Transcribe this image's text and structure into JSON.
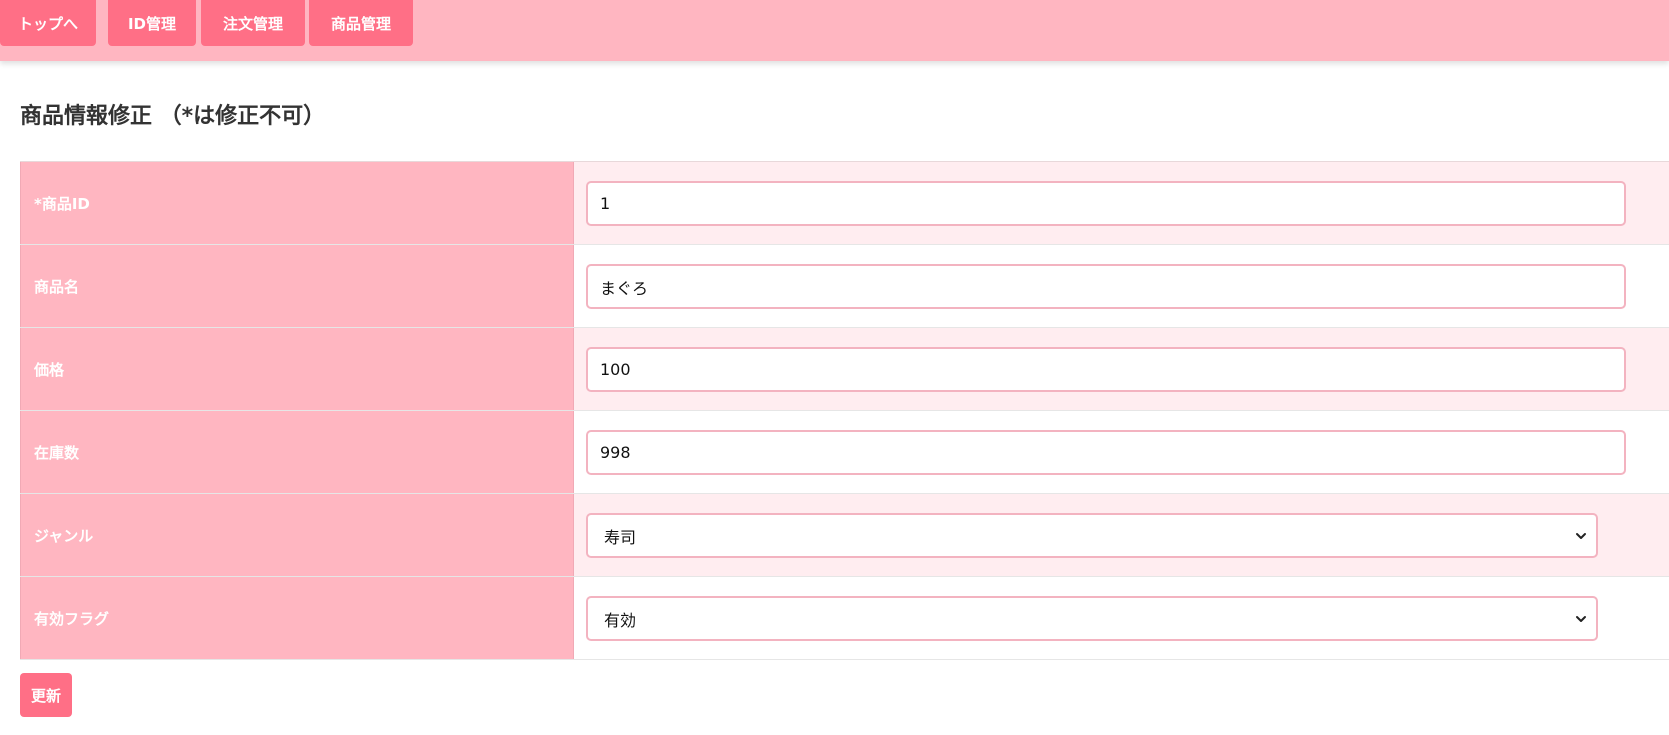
{
  "nav": {
    "items": [
      {
        "label": "トップへ"
      },
      {
        "label": "ID管理"
      },
      {
        "label": "注文管理"
      },
      {
        "label": "商品管理"
      }
    ]
  },
  "page": {
    "title": "商品情報修正 （*は修正不可）"
  },
  "form": {
    "product_id": {
      "label": "*商品ID",
      "value": "1"
    },
    "product_name": {
      "label": "商品名",
      "value": "まぐろ"
    },
    "price": {
      "label": "価格",
      "value": "100"
    },
    "stock": {
      "label": "在庫数",
      "value": "998"
    },
    "genre": {
      "label": "ジャンル",
      "selected": "寿司"
    },
    "active_flag": {
      "label": "有効フラグ",
      "selected": "有効"
    }
  },
  "actions": {
    "update_label": "更新"
  },
  "colors": {
    "header_bg": "#ffb6c1",
    "button_bg": "#ff6f86",
    "label_bg": "#ffb6c1",
    "alt_row_bg": "#ffedf0",
    "input_border": "#f3b3c0"
  },
  "icons": {
    "select_arrow": "chevron-down-icon"
  }
}
